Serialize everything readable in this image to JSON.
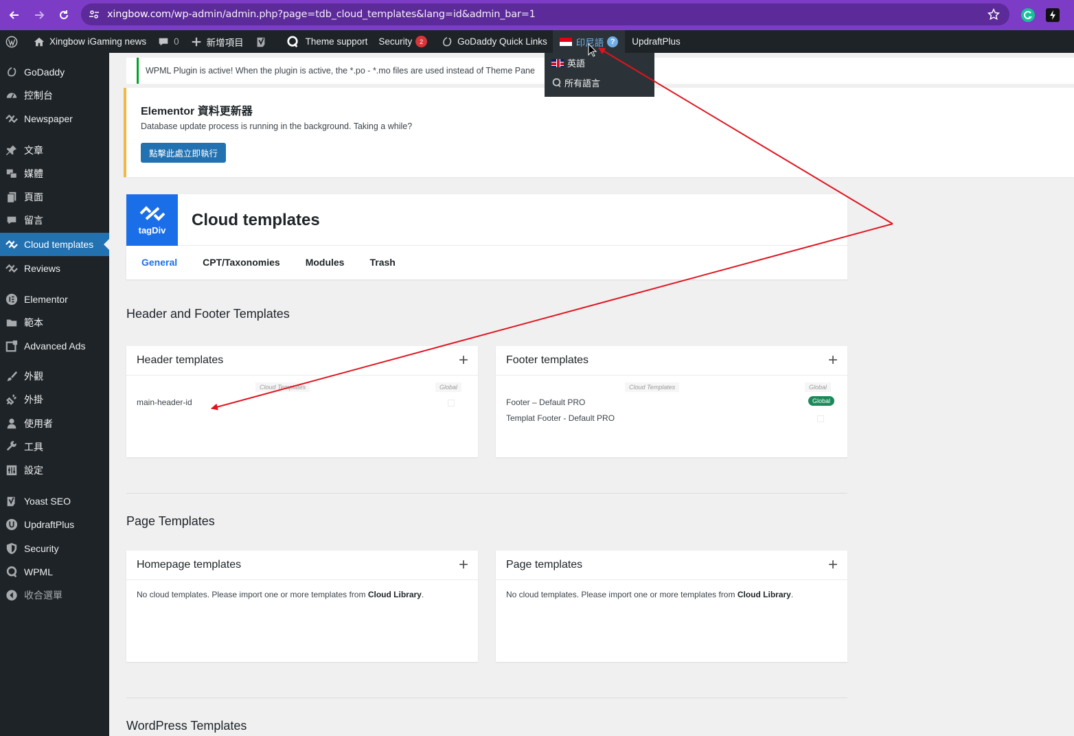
{
  "browser": {
    "url_host": "xingbow.com",
    "url_path": "/wp-admin/admin.php?page=tdb_cloud_templates&lang=id&admin_bar=1",
    "theme_color": "#7d3cc6"
  },
  "admin_bar": {
    "site_name": "Xingbow iGaming news",
    "comments_count": "0",
    "new_item": "新增項目",
    "theme_support": "Theme support",
    "security": "Security",
    "security_badge": "2",
    "godaddy_links": "GoDaddy Quick Links",
    "current_language": "印尼語",
    "updraft": "UpdraftPlus"
  },
  "lang_dropdown": [
    {
      "label": "英語",
      "icon": "uk-flag-icon"
    },
    {
      "label": "所有語言",
      "icon": "wpml-icon"
    }
  ],
  "sidebar": {
    "items": [
      {
        "label": "GoDaddy",
        "icon": "godaddy-icon"
      },
      {
        "label": "控制台",
        "icon": "dashboard-icon"
      },
      {
        "label": "Newspaper",
        "icon": "tagdiv-icon"
      },
      {
        "label": "文章",
        "icon": "pin-icon"
      },
      {
        "label": "媒體",
        "icon": "media-icon"
      },
      {
        "label": "頁面",
        "icon": "page-icon"
      },
      {
        "label": "留言",
        "icon": "comment-icon"
      },
      {
        "label": "Cloud templates",
        "icon": "tagdiv-icon",
        "active": true
      },
      {
        "label": "Reviews",
        "icon": "tagdiv-icon"
      },
      {
        "label": "Elementor",
        "icon": "elementor-icon"
      },
      {
        "label": "範本",
        "icon": "folder-icon"
      },
      {
        "label": "Advanced Ads",
        "icon": "ads-icon"
      },
      {
        "label": "外觀",
        "icon": "brush-icon"
      },
      {
        "label": "外掛",
        "icon": "plugin-icon"
      },
      {
        "label": "使用者",
        "icon": "user-icon"
      },
      {
        "label": "工具",
        "icon": "wrench-icon"
      },
      {
        "label": "設定",
        "icon": "settings-icon"
      },
      {
        "label": "Yoast SEO",
        "icon": "yoast-icon"
      },
      {
        "label": "UpdraftPlus",
        "icon": "updraft-icon"
      },
      {
        "label": "Security",
        "icon": "shield-icon"
      },
      {
        "label": "WPML",
        "icon": "wpml-icon"
      },
      {
        "label": "收合選單",
        "icon": "collapse-icon"
      }
    ]
  },
  "notices": {
    "wpml": "WPML Plugin is active! When the plugin is active, the *.po - *.mo files are used instead of Theme Pane",
    "elementor_title": "Elementor 資料更新器",
    "elementor_text": "Database update process is running in the background. Taking a while?",
    "elementor_button": "點擊此處立即執行"
  },
  "cloud": {
    "logo_text": "tagDiv",
    "title": "Cloud templates",
    "tabs": [
      "General",
      "CPT/Taxonomies",
      "Modules",
      "Trash"
    ]
  },
  "sections": {
    "header_footer": "Header and Footer Templates",
    "page": "Page Templates",
    "wordpress": "WordPress Templates"
  },
  "cards": {
    "col_cloud": "Cloud Templates",
    "col_global": "Global",
    "header": {
      "title": "Header templates",
      "rows": [
        {
          "name": "main-header-id",
          "global": false
        }
      ]
    },
    "footer": {
      "title": "Footer templates",
      "rows": [
        {
          "name": "Footer – Default PRO",
          "global": true,
          "badge": "Global"
        },
        {
          "name": "Templat Footer - Default PRO",
          "global": false
        }
      ]
    },
    "homepage": {
      "title": "Homepage templates",
      "empty_text": "No cloud templates. Please import one or more templates from ",
      "empty_link": "Cloud Library",
      "empty_end": "."
    },
    "page": {
      "title": "Page templates",
      "empty_text": "No cloud templates. Please import one or more templates from ",
      "empty_link": "Cloud Library",
      "empty_end": "."
    }
  },
  "colors": {
    "accent": "#2271b1",
    "annotation": "#e0141e",
    "tagdiv": "#1a6fe8"
  }
}
